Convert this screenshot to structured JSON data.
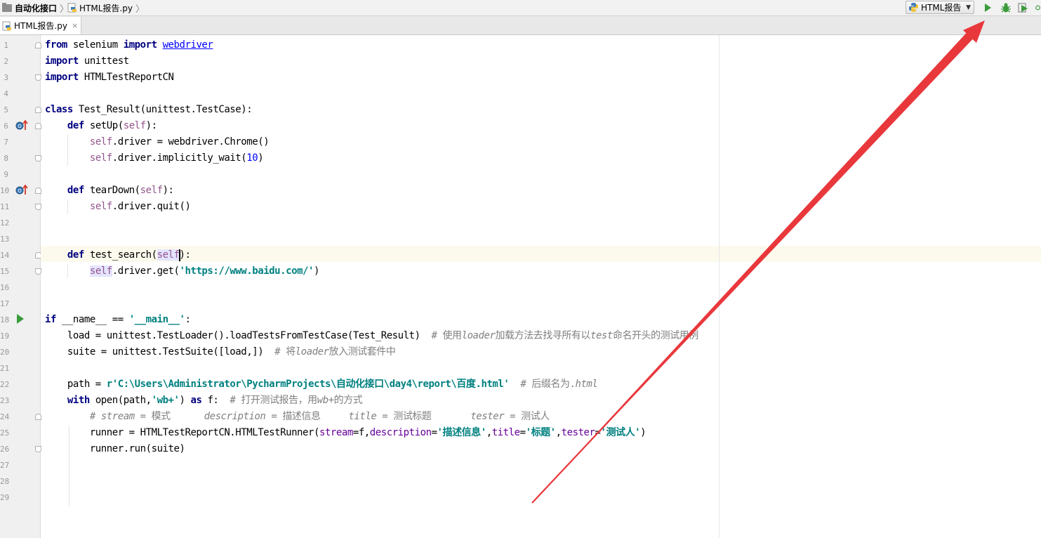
{
  "navbar": {
    "project": "自动化接口",
    "file": "HTML报告.py",
    "run_config": "HTML报告"
  },
  "tab": {
    "label": "HTML报告.py",
    "close": "×"
  },
  "line_numbers": [
    "1",
    "2",
    "3",
    "4",
    "5",
    "6",
    "7",
    "8",
    "9",
    "10",
    "11",
    "12",
    "13",
    "14",
    "15",
    "16",
    "17",
    "18",
    "19",
    "20",
    "21",
    "22",
    "23",
    "24",
    "25",
    "26",
    "27",
    "28",
    "29"
  ],
  "code": {
    "l1": [
      "from",
      " selenium ",
      "import",
      " ",
      "webdriver"
    ],
    "l2": [
      "import",
      " unittest"
    ],
    "l3": [
      "import",
      " HTMLTestReportCN"
    ],
    "l5": [
      "class",
      " Test_Result(unittest.TestCase):"
    ],
    "l6": [
      "    ",
      "def",
      " setUp(",
      "self",
      "):"
    ],
    "l7": [
      "        ",
      "self",
      ".driver = webdriver.Chrome()"
    ],
    "l8": [
      "        ",
      "self",
      ".driver.implicitly_wait(",
      "10",
      ")"
    ],
    "l10": [
      "    ",
      "def",
      " tearDown(",
      "self",
      "):"
    ],
    "l11": [
      "        ",
      "self",
      ".driver.quit()"
    ],
    "l14": [
      "    ",
      "def",
      " test_search(",
      "self",
      "):"
    ],
    "l15": [
      "        ",
      "self",
      ".driver.get(",
      "'https://www.baidu.com/'",
      ")"
    ],
    "l18": [
      "if",
      " __name__ == ",
      "'__main__'",
      ":"
    ],
    "l19": [
      "    load = unittest.TestLoader().loadTestsFromTestCase(Test_Result)  ",
      "# 使用",
      "loader",
      "加载方法去找寻所有以",
      "test",
      "命名开头的测试用例"
    ],
    "l20": [
      "    suite = unittest.TestSuite([load,])  ",
      "# 将",
      "loader",
      "放入测试套件中"
    ],
    "l22": [
      "    path = ",
      "r'C:\\Users\\Administrator\\PycharmProjects\\自动化接口\\day4\\report\\百度.html'",
      "  ",
      "# 后缀名为.",
      "html"
    ],
    "l23": [
      "    ",
      "with",
      " open(path,",
      "'wb+'",
      ") ",
      "as",
      " f:  ",
      "# 打开测试报告，用",
      "wb+",
      "的方式"
    ],
    "l24": [
      "        ",
      "# stream",
      " = 模式      ",
      "description",
      " = 描述信息     ",
      "title",
      " = 测试标题       ",
      "tester",
      " = 测试人"
    ],
    "l25": [
      "        runner = HTMLTestReportCN.HTMLTestRunner(",
      "stream",
      "=f,",
      "description",
      "=",
      "'描述信息'",
      ",",
      "title",
      "=",
      "'标题'",
      ",",
      "tester",
      "=",
      "'测试人'",
      ")"
    ],
    "l26": [
      "        runner.run(suite)"
    ]
  },
  "colors": {
    "keyword": "#000080",
    "self": "#94558d",
    "string": "#008080",
    "number": "#0000ff",
    "comment": "#808080",
    "kwarg": "#660099",
    "arrow": "#e8383c",
    "run_green": "#3a9b3a"
  },
  "icons": [
    "folder-icon",
    "python-file-icon",
    "run-icon",
    "debug-icon",
    "run-coverage-icon",
    "override-icon",
    "gutter-run-icon",
    "close-icon",
    "chevron-down-icon"
  ]
}
